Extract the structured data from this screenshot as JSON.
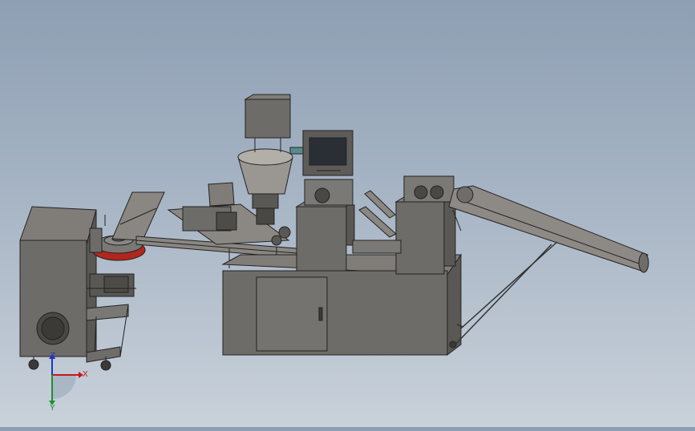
{
  "view": {
    "background_top": "#8e9fb3",
    "background_bottom": "#c9d1da",
    "model_body_color": "#6e6c68",
    "screen_color": "#2a2f36",
    "accent_red": "#b3261e",
    "accent_teal": "#5a8c8c"
  },
  "triad": {
    "x_label": "X",
    "y_label": "Y",
    "z_label": "Z",
    "x_color": "#c0181a",
    "y_color": "#1f8f2a",
    "z_color": "#1c35c4"
  }
}
